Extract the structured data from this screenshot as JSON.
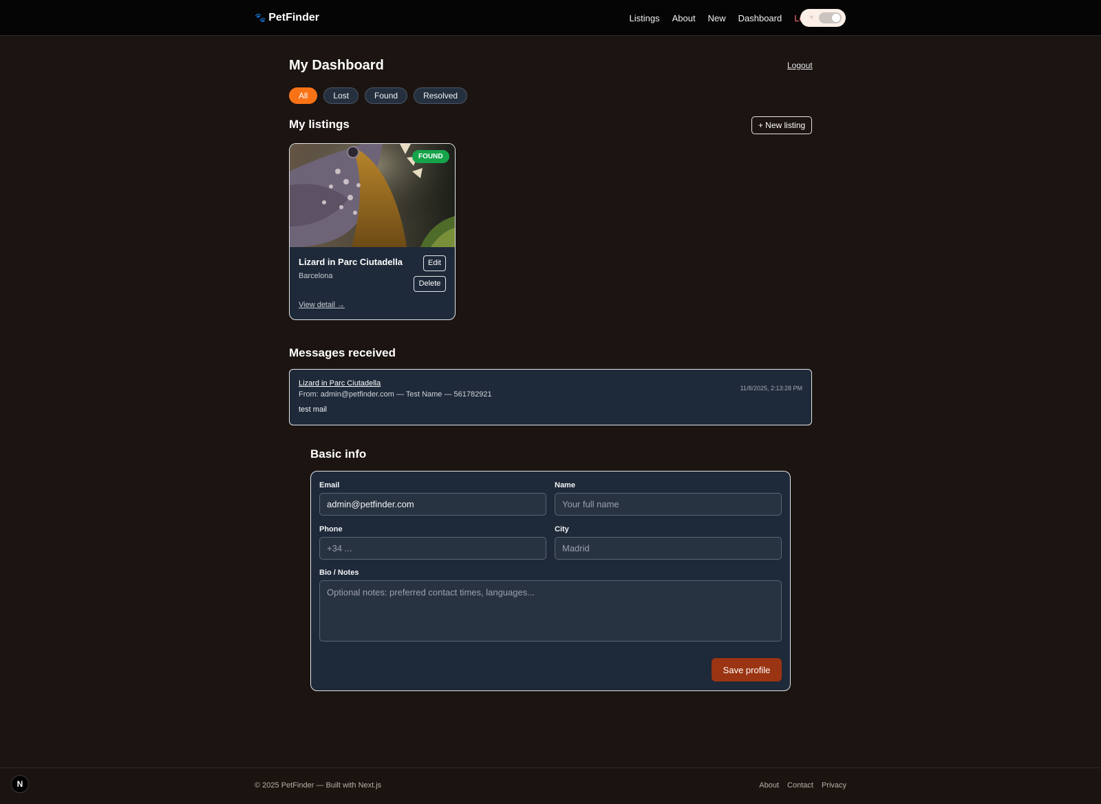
{
  "nav": {
    "brand_icon": "paw-icon",
    "brand": "PetFinder",
    "links": [
      "Listings",
      "About",
      "New",
      "Dashboard"
    ],
    "logout": "Logout",
    "theme_toggle_icon": "sun-icon"
  },
  "dashboard": {
    "title": "My Dashboard",
    "logout": "Logout",
    "filters": [
      "All",
      "Lost",
      "Found",
      "Resolved"
    ],
    "active_filter": "All"
  },
  "listings": {
    "title": "My listings",
    "new_button": "+ New listing",
    "items": [
      {
        "status": "FOUND",
        "title": "Lizard in Parc Ciutadella",
        "city": "Barcelona",
        "edit": "Edit",
        "delete": "Delete",
        "link": "View detail →"
      }
    ]
  },
  "messages": {
    "title": "Messages received",
    "items": [
      {
        "subject": "Lizard in Parc Ciutadella",
        "from": "From: admin@petfinder.com — Test Name — 561782921",
        "body": "test mail",
        "time": "11/8/2025, 2:13:28 PM"
      }
    ]
  },
  "profile": {
    "title": "Basic info",
    "email_label": "Email",
    "email_value": "admin@petfinder.com",
    "name_label": "Name",
    "name_placeholder": "Your full name",
    "phone_label": "Phone",
    "phone_placeholder": "+34 ...",
    "city_label": "City",
    "city_placeholder": "Madrid",
    "bio_label": "Bio / Notes",
    "bio_placeholder": "Optional notes: preferred contact times, languages...",
    "save_button": "Save profile"
  },
  "footer": {
    "copyright": "© 2025 PetFinder — Built with Next.js",
    "links": [
      "About",
      "Contact",
      "Privacy"
    ],
    "dev_badge": "N"
  },
  "colors": {
    "accent": "#f97316",
    "found_badge": "#16a34a",
    "save_button": "#9a3412",
    "logout": "#f87171"
  }
}
